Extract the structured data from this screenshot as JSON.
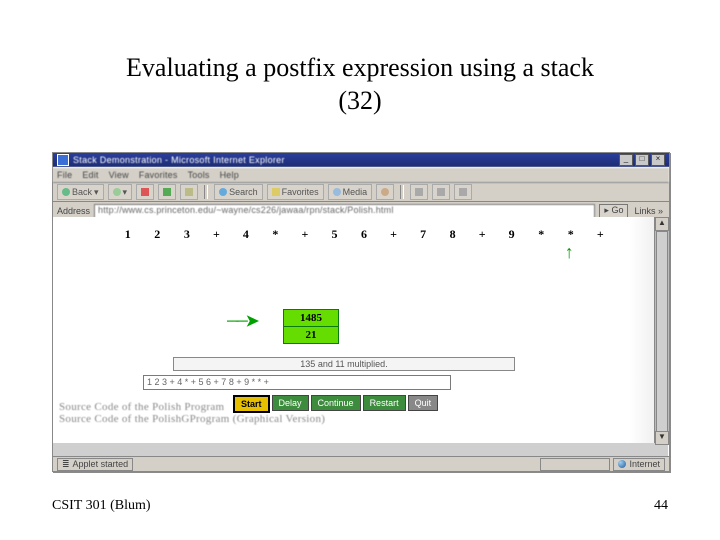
{
  "slide": {
    "title_line1": "Evaluating a postfix expression using a stack",
    "title_line2": "(32)",
    "footer_left": "CSIT 301 (Blum)",
    "page_number": "44"
  },
  "browser": {
    "window_title": "Stack Demonstration - Microsoft Internet Explorer",
    "menus": [
      "File",
      "Edit",
      "View",
      "Favorites",
      "Tools",
      "Help"
    ],
    "toolbar": {
      "back": "Back",
      "forward": "",
      "stop": "",
      "refresh": "",
      "home": "",
      "search": "Search",
      "favorites": "Favorites",
      "media": "Media",
      "history": ""
    },
    "address_label": "Address",
    "address_url": "http://www.cs.princeton.edu/~wayne/cs226/jawaa/rpn/stack/Polish.html",
    "go_label": "Go",
    "links_label": "Links »",
    "status_left": "Applet started",
    "status_right": "Internet"
  },
  "applet": {
    "tokens": [
      "1",
      "2",
      "3",
      "+",
      "4",
      "*",
      "+",
      "5",
      "6",
      "+",
      "7",
      "8",
      "+",
      "9",
      "*",
      "*",
      "+"
    ],
    "pointer_index": 15,
    "stack": [
      "1485",
      "21"
    ],
    "message": "135 and 11 multiplied.",
    "input_expression": "1 2 3 + 4 * + 5 6 + 7 8 + 9 * * +",
    "buttons": {
      "start": "Start",
      "delay": "Delay",
      "continue": "Continue",
      "restart": "Restart",
      "quit": "Quit"
    },
    "links_line1": "Source Code of the Polish Program",
    "links_line2": "Source Code of the PolishGProgram (Graphical Version)"
  }
}
